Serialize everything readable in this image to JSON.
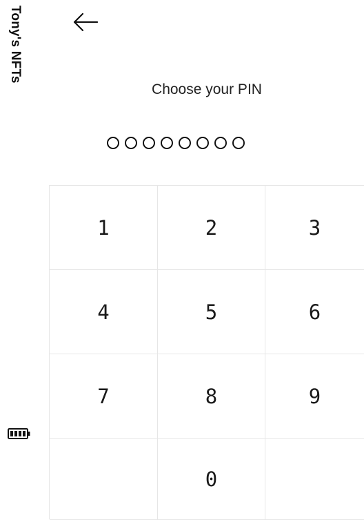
{
  "app": {
    "title": "Tony's NFTs"
  },
  "icons": {
    "back": "back-arrow-icon",
    "battery": "battery-icon"
  },
  "pin": {
    "prompt": "Choose your PIN",
    "length": 8,
    "entered": 0
  },
  "keypad": {
    "keys": [
      "1",
      "2",
      "3",
      "4",
      "5",
      "6",
      "7",
      "8",
      "9",
      "",
      "0",
      ""
    ]
  },
  "colors": {
    "text": "#111111",
    "grid_line": "#e6e6e6",
    "background": "#ffffff"
  }
}
